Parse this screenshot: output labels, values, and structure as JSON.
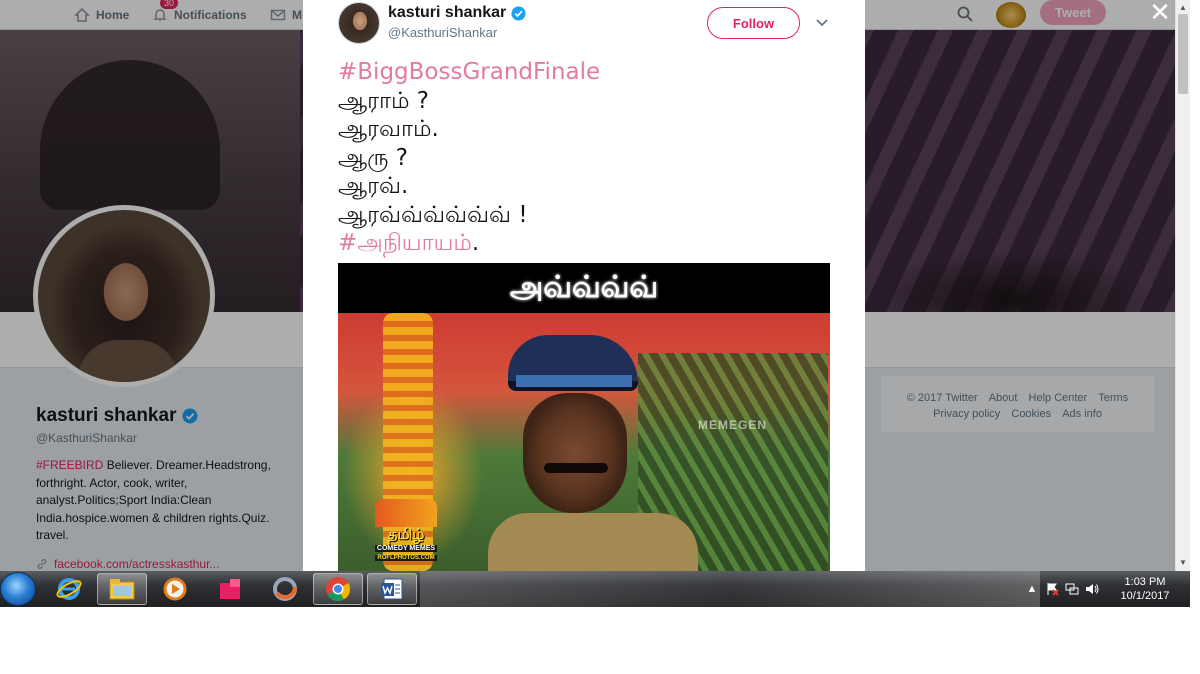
{
  "top_nav": {
    "home": "Home",
    "notifications": "Notifications",
    "notifications_count": "30",
    "messages": "M",
    "tweet_button": "Tweet"
  },
  "profile": {
    "name": "kasturi shankar",
    "handle": "@KasthuriShankar",
    "bio_hashtag": "#FREEBIRD",
    "bio_text": " Believer. Dreamer.Headstrong, forthright. Actor, cook, writer, analyst.Politics;Sport India:Clean India.hospice.women & children rights.Quiz. travel.",
    "link": "facebook.com/actresskasthur..."
  },
  "footer": {
    "links_row1": [
      "© 2017 Twitter",
      "About",
      "Help Center",
      "Terms"
    ],
    "links_row2": [
      "Privacy policy",
      "Cookies",
      "Ads info"
    ]
  },
  "tweet": {
    "author_name": "kasturi shankar",
    "author_handle": "@KasthuriShankar",
    "follow_label": "Follow",
    "hashtag_top": "#BiggBossGrandFinale",
    "lines": [
      "ஆராம் ?",
      "ஆரவாம்.",
      "ஆரு ?",
      "ஆரவ்.",
      "ஆரவ்வ்வ்வ்வ்வ் !"
    ],
    "hashtag_bottom": "#அநியாயம்",
    "hashtag_bottom_suffix": ".",
    "meme_caption": "அவ்வ்வ்வ்",
    "meme_watermark": "MEMEGEN",
    "meme_logo_text": "தமிழ்",
    "meme_logo_sub1": "COMEDY MEMES",
    "meme_logo_sub2": "ROFLPHOTOS.COM"
  },
  "taskbar": {
    "time": "1:03 PM",
    "date": "10/1/2017"
  },
  "colors": {
    "accent_pink": "#e0245e",
    "hashtag_pink": "#e37aa0",
    "taskbar_dark": "#1e2022"
  },
  "icons": [
    "home-icon",
    "bell-icon",
    "mail-icon",
    "search-icon",
    "verified-badge-icon",
    "chevron-down-icon",
    "close-icon",
    "link-icon",
    "start-orb-icon",
    "ie-icon",
    "folder-icon",
    "media-player-icon",
    "pink-app-icon",
    "firefox-icon",
    "chrome-icon",
    "word-icon",
    "speaker-icon",
    "network-icon",
    "flag-icon"
  ]
}
